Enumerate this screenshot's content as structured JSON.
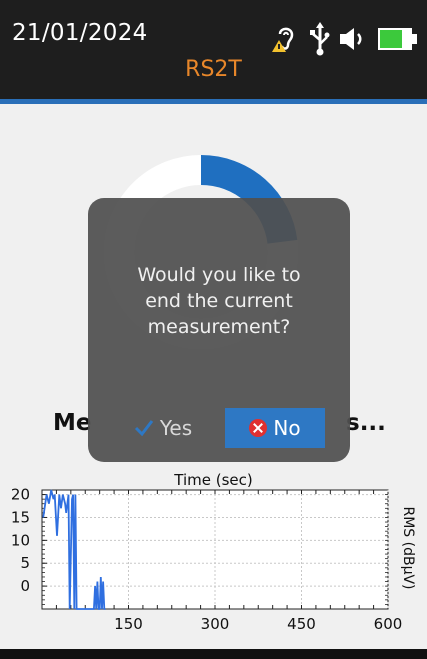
{
  "status_bar": {
    "date": "21/01/2024",
    "title": "RS2T",
    "icons": [
      "hearing-warning-icon",
      "usb-icon",
      "speaker-icon",
      "battery-icon"
    ]
  },
  "main": {
    "measure_left": "Me",
    "measure_right": "s...",
    "progress_fraction": 0.23
  },
  "dialog": {
    "message_line1": "Would you like to",
    "message_line2": "end the current",
    "message_line3": "measurement?",
    "yes_label": "Yes",
    "no_label": "No"
  },
  "colors": {
    "accent": "#2a6fb8",
    "title": "#e8872a",
    "no_button": "#2e78c4",
    "plot_line": "#2f6fe0"
  },
  "chart_data": {
    "type": "line",
    "title": "Time (sec)",
    "xlabel": "Time (sec)",
    "ylabel": "RMS (dBµV)",
    "xlim": [
      0,
      600
    ],
    "ylim": [
      -5,
      21
    ],
    "x_ticks": [
      "150",
      "300",
      "450",
      "600"
    ],
    "y_ticks": [
      "20",
      "15",
      "10",
      "5",
      "0"
    ],
    "grid": true,
    "series": [
      {
        "x": [
          2,
          8,
          12,
          16,
          20,
          22,
          26,
          30,
          33,
          36,
          40,
          42,
          46,
          48,
          52,
          54,
          56,
          58,
          60,
          62,
          66,
          70,
          72,
          74,
          76,
          78,
          80,
          82,
          84,
          86,
          88,
          90,
          92,
          94,
          96,
          98,
          100,
          102,
          104,
          106,
          108,
          110
        ],
        "y": [
          15,
          20,
          18,
          21,
          19,
          20,
          11,
          20,
          17,
          20,
          18,
          16,
          20,
          -5,
          19,
          20,
          -5,
          20,
          -5,
          -5,
          -5,
          -5,
          -5,
          -5,
          -5,
          -5,
          -5,
          -5,
          -5,
          -5,
          -5,
          -5,
          0,
          -5,
          1,
          -5,
          -5,
          2,
          -5,
          1,
          -5,
          -5
        ]
      }
    ]
  }
}
